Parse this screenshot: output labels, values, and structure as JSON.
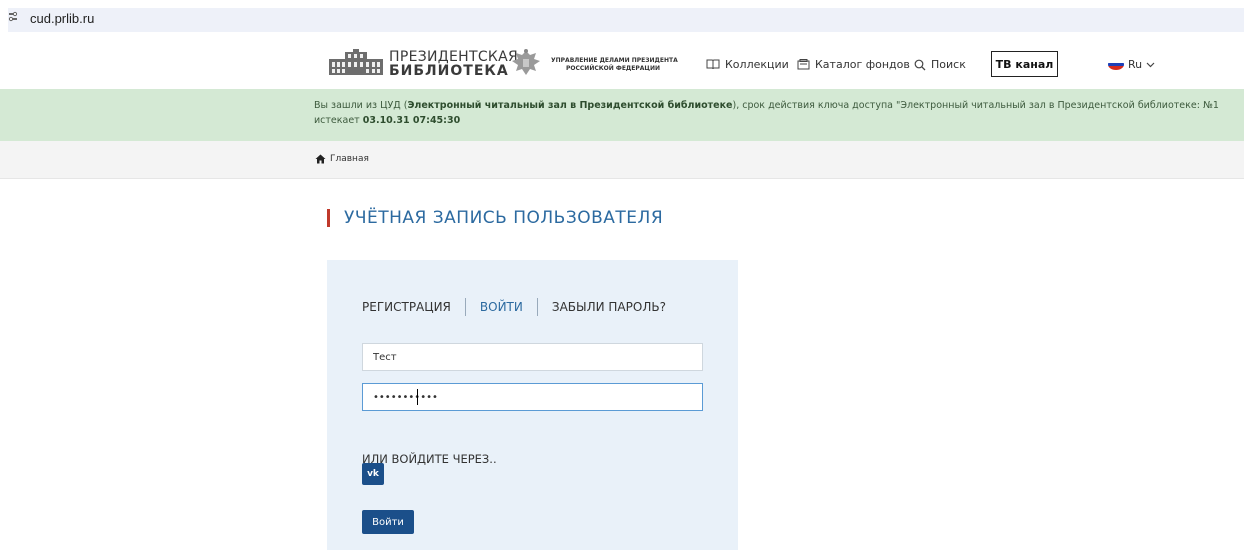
{
  "browser": {
    "url": "cud.prlib.ru"
  },
  "header": {
    "logo_line1": "ПРЕЗИДЕНТСКАЯ",
    "logo_line2": "БИБЛИОТЕКА",
    "gov_line1": "УПРАВЛЕНИЕ ДЕЛАМИ ПРЕЗИДЕНТА",
    "gov_line2": "РОССИЙСКОЙ ФЕДЕРАЦИИ",
    "nav": {
      "collections": "Коллекции",
      "catalog": "Каталог фондов",
      "search": "Поиск"
    },
    "tv_button": "ТВ канал",
    "language": "Ru"
  },
  "notice": {
    "part1": "Вы зашли из ЦУД (",
    "part2_bold": "Электронный читальный зал в Президентской библиотеке",
    "part3": "), срок действия ключа доступа \"Электронный читальный зал в Президентской библиотеке: №1",
    "part4": "истекает ",
    "part5_bold": "03.10.31 07:45:30"
  },
  "breadcrumb": {
    "home": "Главная"
  },
  "page": {
    "title": "УЧЁТНАЯ ЗАПИСЬ ПОЛЬЗОВАТЕЛЯ"
  },
  "login": {
    "tabs": {
      "register": "РЕГИСТРАЦИЯ",
      "login": "ВОЙТИ",
      "forgot": "ЗАБЫЛИ ПАРОЛЬ?"
    },
    "username_value": "Тест",
    "password_value": "•••••••••••",
    "or_label": "ИЛИ ВОЙДИТЕ ЧЕРЕЗ..",
    "vk_label": "vk",
    "submit_label": "Войти"
  },
  "colors": {
    "accent": "#2c6aa0",
    "button": "#1b4f8a",
    "notice_bg": "#d4e9d4",
    "title_marker": "#c0392b"
  }
}
